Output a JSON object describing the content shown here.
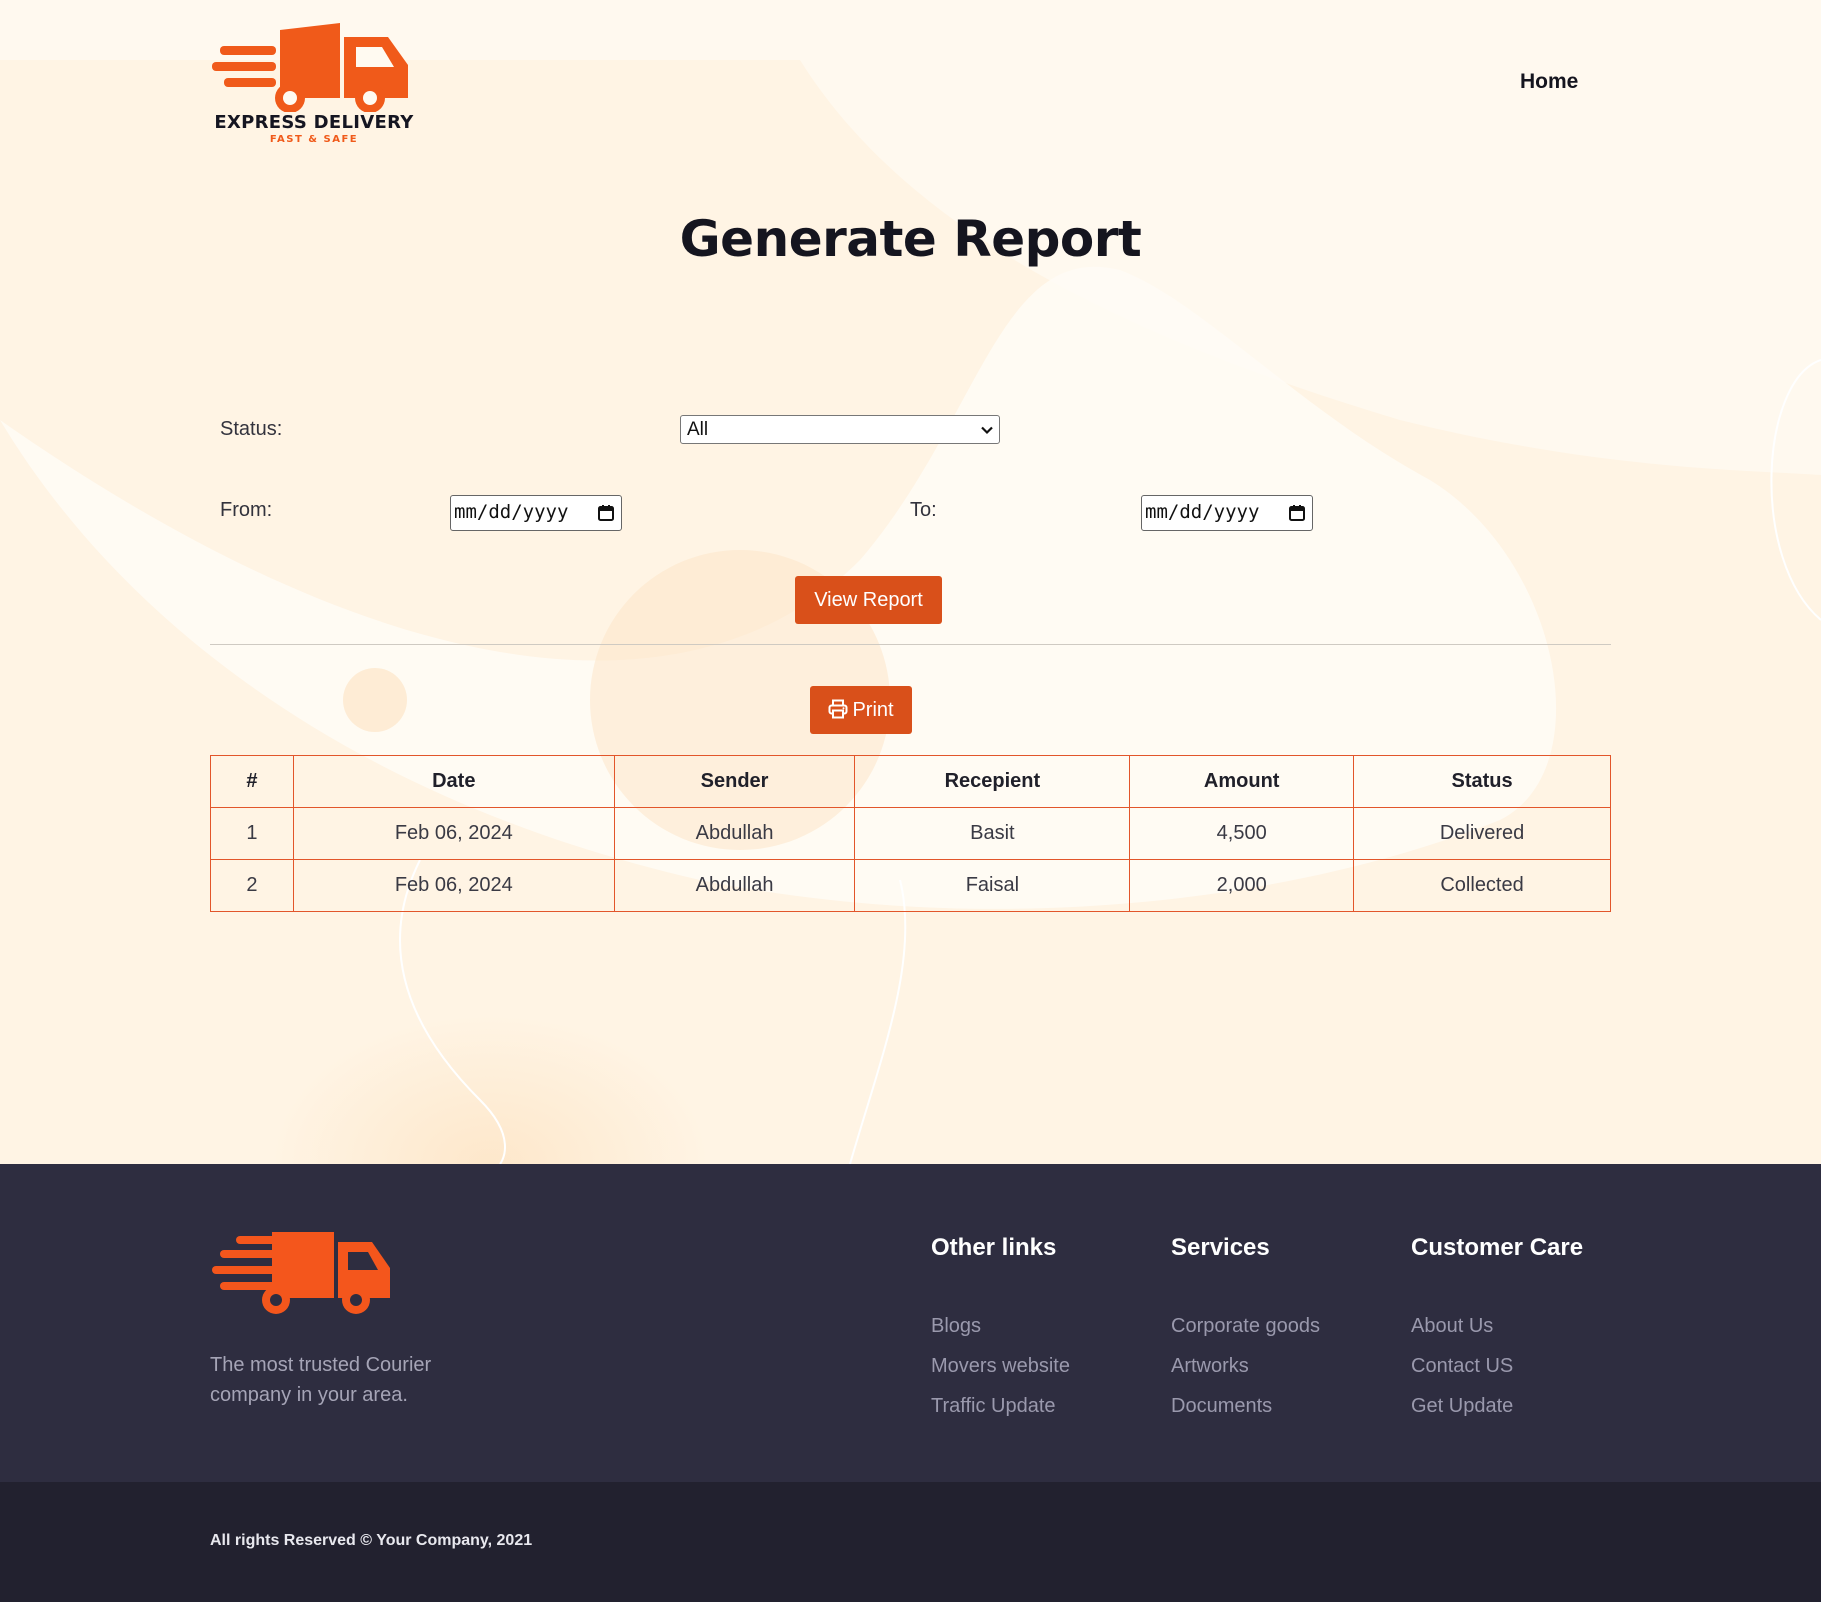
{
  "brand": {
    "name": "EXPRESS DELIVERY",
    "tagline": "FAST & SAFE"
  },
  "nav": {
    "home": "Home"
  },
  "page": {
    "title": "Generate Report"
  },
  "form": {
    "status_label": "Status:",
    "status_value": "All",
    "from_label": "From:",
    "from_placeholder": "mm/dd/yyyy",
    "to_label": "To:",
    "to_placeholder": "mm/dd/yyyy",
    "view_button": "View Report",
    "print_button": "Print"
  },
  "table": {
    "headers": [
      "#",
      "Date",
      "Sender",
      "Recepient",
      "Amount",
      "Status"
    ],
    "rows": [
      [
        "1",
        "Feb 06, 2024",
        "Abdullah",
        "Basit",
        "4,500",
        "Delivered"
      ],
      [
        "2",
        "Feb 06, 2024",
        "Abdullah",
        "Faisal",
        "2,000",
        "Collected"
      ]
    ]
  },
  "footer": {
    "tagline": "The most trusted Courier company in your area.",
    "columns": [
      {
        "title": "Other links",
        "links": [
          "Blogs",
          "Movers website",
          "Traffic Update"
        ]
      },
      {
        "title": "Services",
        "links": [
          "Corporate goods",
          "Artworks",
          "Documents"
        ]
      },
      {
        "title": "Customer Care",
        "links": [
          "About Us",
          "Contact US",
          "Get Update"
        ]
      }
    ],
    "copyright": "All rights Reserved © Your Company, 2021"
  },
  "colors": {
    "accent": "#d9501a",
    "brand_orange": "#f05a1a",
    "footer_bg": "#2e2d40",
    "bottom_bar_bg": "#22212f",
    "table_border": "#e2552a"
  },
  "icons": {
    "logo": "delivery-truck-icon",
    "print": "printer-icon",
    "calendar": "calendar-icon",
    "select": "chevron-down-icon"
  }
}
